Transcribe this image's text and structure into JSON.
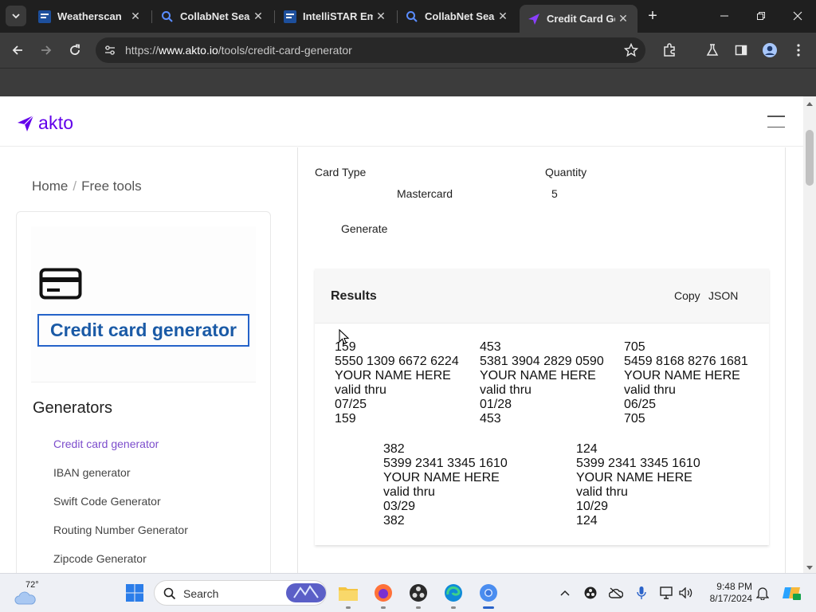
{
  "browser": {
    "tabs": [
      {
        "title": "Weatherscan",
        "favicon": "weatherscan-favicon"
      },
      {
        "title": "CollabNet Sear",
        "favicon": "search-favicon"
      },
      {
        "title": "IntelliSTAR Em",
        "favicon": "weatherscan-favicon"
      },
      {
        "title": "CollabNet Sear",
        "favicon": "search-favicon"
      },
      {
        "title": "Credit Card Ge",
        "favicon": "akto-favicon",
        "active": true
      }
    ],
    "url_prefix": "https://",
    "url_domain": "www.akto.io",
    "url_path": "/tools/credit-card-generator"
  },
  "site": {
    "logo_text": "akto",
    "brand_color": "#6200ea"
  },
  "breadcrumb": {
    "home": "Home",
    "separator": "/",
    "current": "Free tools"
  },
  "sidebar": {
    "tool_title": "Credit card generator",
    "heading": "Generators",
    "items": [
      {
        "label": "Credit card generator",
        "active": true
      },
      {
        "label": "IBAN generator"
      },
      {
        "label": "Swift Code Generator"
      },
      {
        "label": "Routing Number Generator"
      },
      {
        "label": "Zipcode Generator"
      }
    ]
  },
  "form": {
    "card_type_label": "Card Type",
    "card_type_value": "Mastercard",
    "quantity_label": "Quantity",
    "quantity_value": "5",
    "generate_label": "Generate"
  },
  "results": {
    "title": "Results",
    "copy_label": "Copy",
    "json_label": "JSON",
    "cards": [
      {
        "cvv": "159",
        "number": "5550 1309 6672 6224",
        "name": "YOUR NAME HERE",
        "valid_label": "valid thru",
        "expiry": "07/25",
        "cvv2": "159"
      },
      {
        "cvv": "453",
        "number": "5381 3904 2829 0590",
        "name": "YOUR NAME HERE",
        "valid_label": "valid thru",
        "expiry": "01/28",
        "cvv2": "453"
      },
      {
        "cvv": "705",
        "number": "5459 8168 8276 1681",
        "name": "YOUR NAME HERE",
        "valid_label": "valid thru",
        "expiry": "06/25",
        "cvv2": "705"
      },
      {
        "cvv": "382",
        "number": "5399 2341 3345 1610",
        "name": "YOUR NAME HERE",
        "valid_label": "valid thru",
        "expiry": "03/29",
        "cvv2": "382"
      },
      {
        "cvv": "124",
        "number": "5399 2341 3345 1610",
        "name": "YOUR NAME HERE",
        "valid_label": "valid thru",
        "expiry": "10/29",
        "cvv2": "124"
      }
    ]
  },
  "taskbar": {
    "weather_temp": "72°",
    "search_label": "Search",
    "time": "9:48 PM",
    "date": "8/17/2024"
  }
}
